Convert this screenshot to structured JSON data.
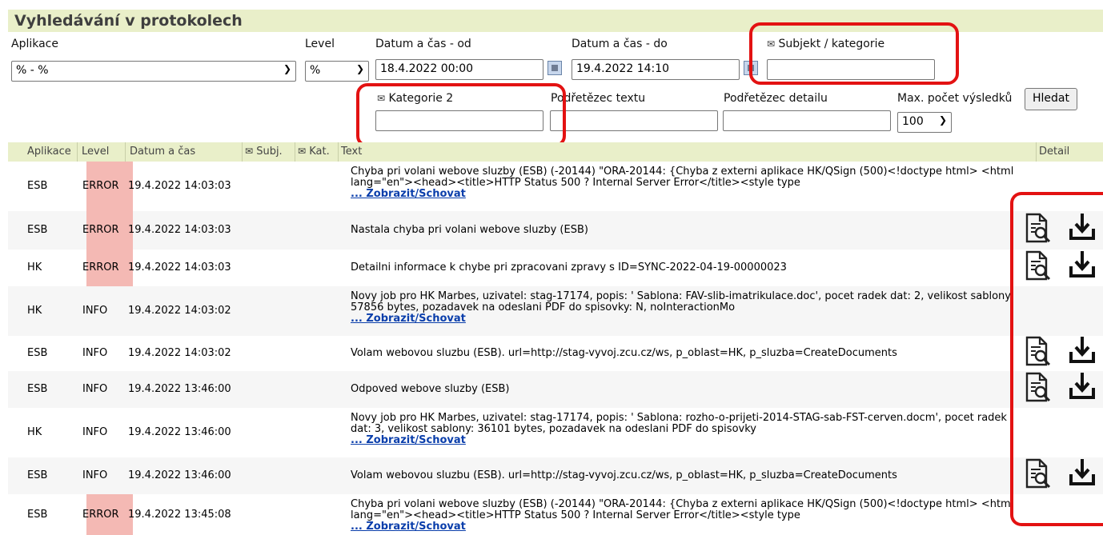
{
  "page": {
    "title": "Vyhledávání v protokolech"
  },
  "filters": {
    "aplikace": {
      "label": "Aplikace",
      "value": "% - %"
    },
    "level": {
      "label": "Level",
      "value": "%"
    },
    "datum_od": {
      "label": "Datum a čas - od",
      "value": "18.4.2022 00:00"
    },
    "datum_do": {
      "label": "Datum a čas - do",
      "value": "19.4.2022 14:10"
    },
    "subjekt": {
      "label": "Subjekt / kategorie",
      "value": ""
    },
    "kategorie2": {
      "label": "Kategorie 2",
      "value": ""
    },
    "podretezec_textu": {
      "label": "Podřetězec textu",
      "value": ""
    },
    "podretezec_detailu": {
      "label": "Podřetězec detailu",
      "value": ""
    },
    "max_pocet": {
      "label": "Max. počet výsledků",
      "value": "100"
    },
    "search_button": "Hledat"
  },
  "table": {
    "columns": {
      "aplikace": "Aplikace",
      "level": "Level",
      "datum": "Datum a čas",
      "subj": "Subj.",
      "kat": "Kat.",
      "text": "Text",
      "detail": "Detail"
    },
    "toggle_label": "... Zobrazit/Schovat",
    "rows": [
      {
        "app": "ESB",
        "level": "ERROR",
        "time": "19.4.2022 14:03:03",
        "text": "Chyba pri volani webove sluzby (ESB) (-20144) \"ORA-20144: {Chyba z externi aplikace HK/QSign (500)<!doctype html> <html lang=\"en\"><head><title>HTTP Status 500 ? Internal Server Error</title><style type"
      },
      {
        "app": "ESB",
        "level": "ERROR",
        "time": "19.4.2022 14:03:03",
        "text": "Nastala chyba pri volani webove sluzby (ESB)"
      },
      {
        "app": "HK",
        "level": "ERROR",
        "time": "19.4.2022 14:03:03",
        "text": "Detailni informace k chybe pri zpracovani zpravy s ID=SYNC-2022-04-19-00000023"
      },
      {
        "app": "HK",
        "level": "INFO",
        "time": "19.4.2022 14:03:02",
        "text": "Novy job pro HK Marbes, uzivatel: stag-17174, popis: ' Šablona: FAV-slib-imatrikulace.doc', pocet radek dat: 2, velikost sablony: 57856 bytes, pozadavek na odeslani PDF do spisovky: N, noInteractionMo"
      },
      {
        "app": "ESB",
        "level": "INFO",
        "time": "19.4.2022 14:03:02",
        "text": "Volam webovou sluzbu (ESB). url=http://stag-vyvoj.zcu.cz/ws, p_oblast=HK, p_sluzba=CreateDocuments"
      },
      {
        "app": "ESB",
        "level": "INFO",
        "time": "19.4.2022 13:46:00",
        "text": "Odpoved webove sluzby (ESB)"
      },
      {
        "app": "HK",
        "level": "INFO",
        "time": "19.4.2022 13:46:00",
        "text": "Novy job pro HK Marbes, uzivatel: stag-17174, popis: ' Šablona: rozho-o-prijeti-2014-STAG-sab-FST-cerven.docm', pocet radek dat: 3, velikost sablony: 36101 bytes, pozadavek na odeslani PDF do spisovky"
      },
      {
        "app": "ESB",
        "level": "INFO",
        "time": "19.4.2022 13:46:00",
        "text": "Volam webovou sluzbu (ESB). url=http://stag-vyvoj.zcu.cz/ws, p_oblast=HK, p_sluzba=CreateDocuments"
      },
      {
        "app": "ESB",
        "level": "ERROR",
        "time": "19.4.2022 13:45:08",
        "text": "Chyba pri volani webove sluzby (ESB) (-20144) \"ORA-20144: {Chyba z externi aplikace HK/QSign (500)<!doctype html> <html lang=\"en\"><head><title>HTTP Status 500 ? Internal Server Error</title><style type"
      }
    ]
  },
  "colors": {
    "header_bg": "#e9efc9",
    "error_bg": "#f4b9b4",
    "highlight": "#e31212",
    "link": "#0a3eab"
  },
  "icons": [
    "document-search-icon",
    "download-icon",
    "calendar-icon",
    "comment-flag-icon"
  ]
}
